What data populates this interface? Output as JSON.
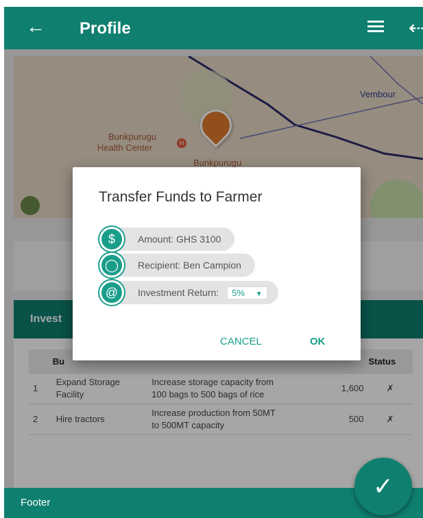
{
  "appbar": {
    "back_icon": "arrow-left-icon",
    "title": "Profile",
    "menu_icon": "menu-icon",
    "logout_icon": "logout-icon"
  },
  "map": {
    "labels": {
      "vembour": "Vembour",
      "health_center_line1": "Bunkpurugu",
      "health_center_line2": "Health Center",
      "town": "Bunkpurugu"
    }
  },
  "investments": {
    "header_partial": "Invest",
    "columns": {
      "budget_partial": "Bu",
      "status": "Status"
    },
    "rows": [
      {
        "num": "1",
        "item": "Expand Storage Facility",
        "purpose": "Increase storage capacity from 100 bags to 500 bags of rice",
        "cost": "1,600",
        "status": "✗"
      },
      {
        "num": "2",
        "item": "Hire tractors",
        "purpose": "Increase production from 50MT to 500MT capacity",
        "cost": "500",
        "status": "✗"
      }
    ]
  },
  "footer": {
    "label": "Footer"
  },
  "fab": {
    "icon": "check-icon"
  },
  "dialog": {
    "title": "Transfer Funds to Farmer",
    "amount": "Amount: GHS 3100",
    "recipient": "Recipient: Ben Campion",
    "return_label": "Investment Return:",
    "return_value": "5%",
    "cancel": "CANCEL",
    "ok": "OK"
  },
  "colors": {
    "primary": "#0f7f6f",
    "accent": "#1a9e8c",
    "marker": "#e07a2a"
  }
}
